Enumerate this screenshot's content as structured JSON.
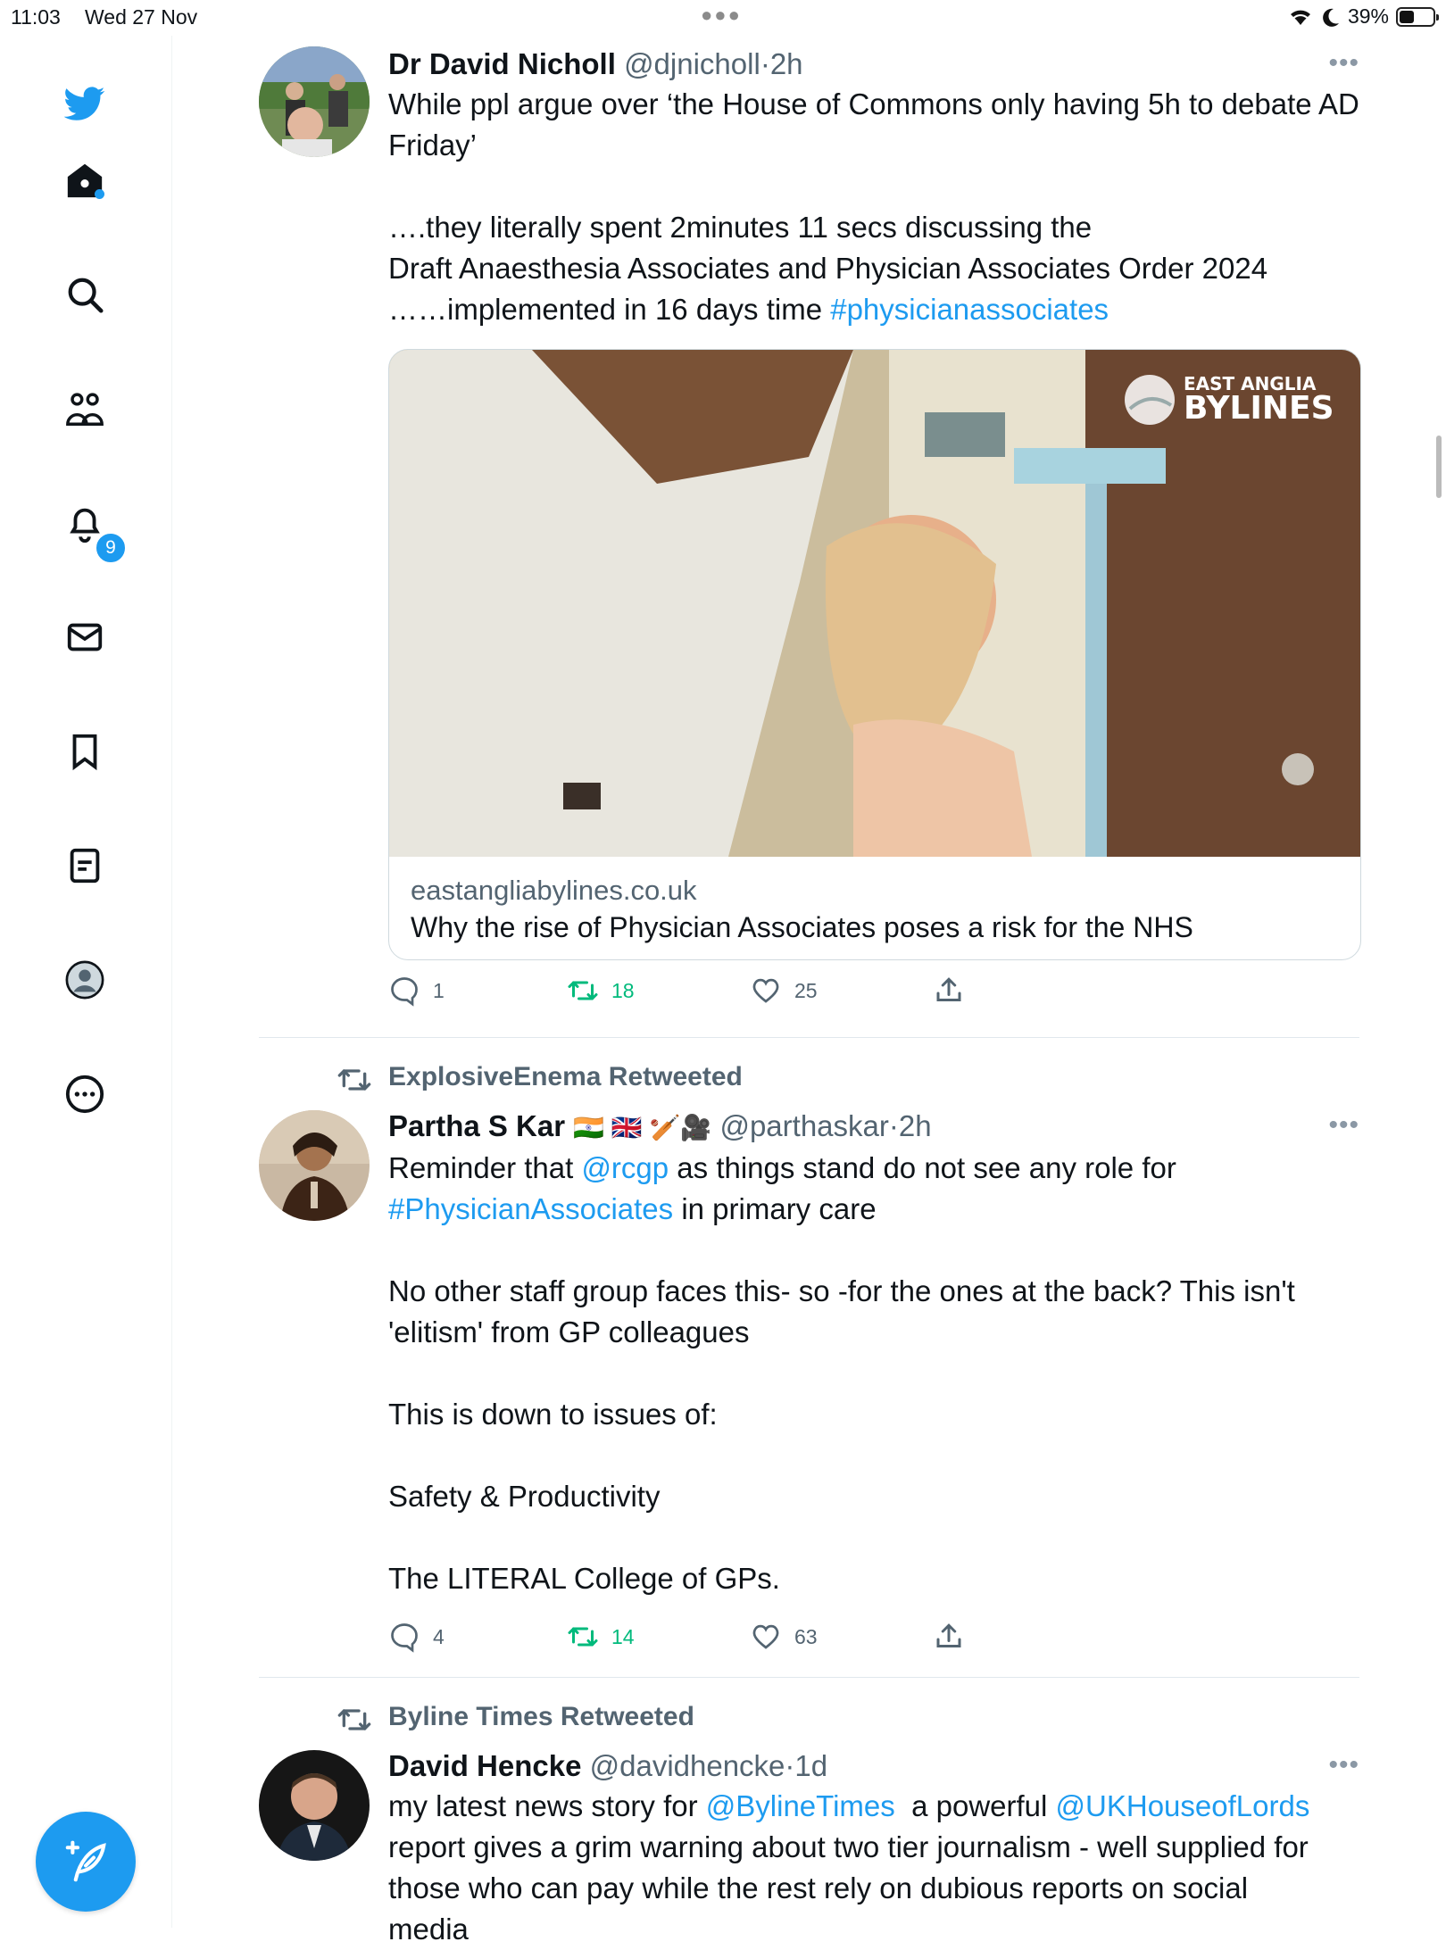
{
  "status_bar": {
    "time": "11:03",
    "date": "Wed 27 Nov",
    "battery": "39%"
  },
  "sidebar": {
    "notifications_badge": "9"
  },
  "tweets": [
    {
      "name": "Dr David Nicholl",
      "handle": "@djnicholl",
      "separator": "·",
      "time": "2h",
      "text_line1": "While ppl argue over ‘the House of Commons only having 5h to debate AD Friday’",
      "text_line2": "….they literally spent 2minutes 11 secs discussing the",
      "text_line3": "Draft Anaesthesia Associates and Physician Associates Order 2024",
      "text_line4_prefix": "……implemented in 16 days time ",
      "hashtag": "#physicianassociates",
      "card": {
        "logo_line1": "EAST ANGLIA",
        "logo_line2": "BYLINES",
        "domain": "eastangliabylines.co.uk",
        "title": "Why the rise of Physician Associates poses a risk for the NHS"
      },
      "replies": "1",
      "retweets": "18",
      "likes": "25"
    },
    {
      "retweeted_by": "ExplosiveEnema Retweeted",
      "name": "Partha S Kar",
      "name_emoji": "🇮🇳 🇬🇧 🏏🎥",
      "handle": "@parthaskar",
      "separator": "·",
      "time": "2h",
      "line1_prefix": "Reminder that ",
      "mention": "@rcgp",
      "line1_suffix": " as things stand do not see any role for",
      "hashtag": "#PhysicianAssociates",
      "line2_suffix": " in primary care",
      "para2": "No other staff group faces this- so -for the ones at the back? This isn't 'elitism' from GP colleagues",
      "para3": "This is down to issues of:",
      "para4": "Safety & Productivity",
      "para5": "The LITERAL College of GPs.",
      "replies": "4",
      "retweets": "14",
      "likes": "63"
    },
    {
      "retweeted_by": "Byline Times Retweeted",
      "name": "David Hencke",
      "handle": "@davidhencke",
      "separator": "·",
      "time": "1d",
      "line1_prefix": "my latest news story for ",
      "mention1": "@BylineTimes",
      "line1_mid": "  a powerful ",
      "mention2": "@UKHouseofLords",
      "line2": "report gives a grim warning about two tier journalism - well supplied for those who can pay while the rest rely on dubious reports on social",
      "line3": "media"
    }
  ],
  "colors": {
    "accent": "#1d9bf0",
    "retweet_green": "#00ba7c",
    "muted": "#536471"
  }
}
